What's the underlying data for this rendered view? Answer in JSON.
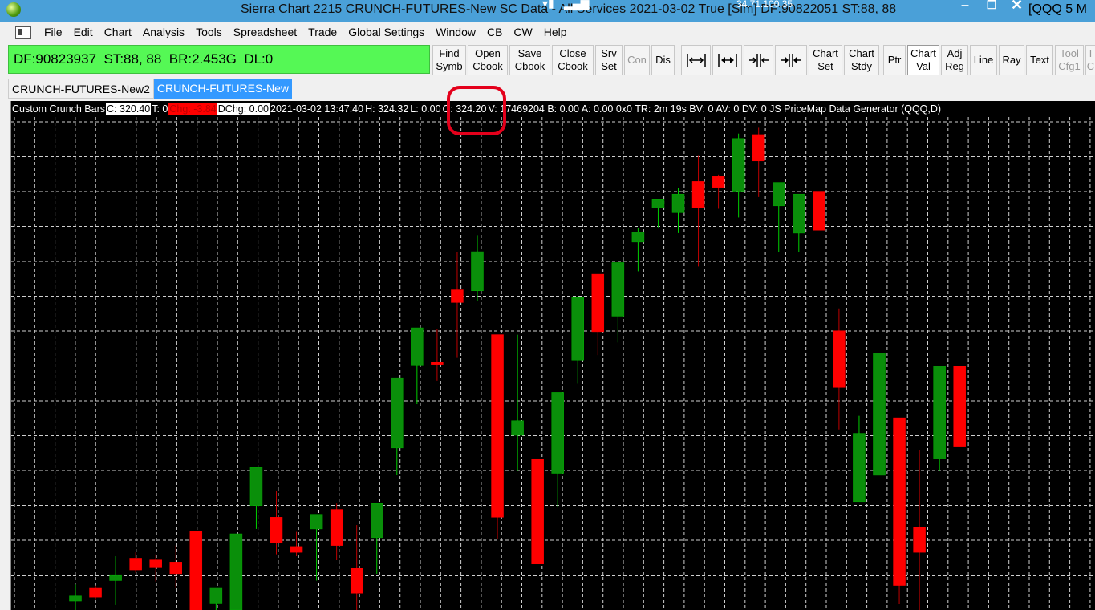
{
  "titlebar": {
    "title": "Sierra Chart 2215 CRUNCH-FUTURES-New   SC Data - All Services 2021-03-02   True [Sim]  DF:90822051  ST:88, 88",
    "ip": "34.71.100.35",
    "right_text": "[QQQ  5 M"
  },
  "menubar": {
    "items": [
      "File",
      "Edit",
      "Chart",
      "Analysis",
      "Tools",
      "Spreadsheet",
      "Trade",
      "Global Settings",
      "Window",
      "CB",
      "CW",
      "Help"
    ]
  },
  "status_panel": {
    "df": "DF:90823937",
    "st": "ST:88, 88",
    "br": "BR:2.453G",
    "dl": "DL:0",
    "color": "#55f855"
  },
  "toolbar": {
    "find_symb": [
      "Find",
      "Symb"
    ],
    "open_cbook": [
      "Open",
      "Cbook"
    ],
    "save_cbook": [
      "Save",
      "Cbook"
    ],
    "close_cbook": [
      "Close",
      "Cbook"
    ],
    "srv_set": [
      "Srv",
      "Set"
    ],
    "con": "Con",
    "dis": "Dis",
    "chart_set": [
      "Chart",
      "Set"
    ],
    "chart_stdy": [
      "Chart",
      "Stdy"
    ],
    "ptr": "Ptr",
    "chart_val": [
      "Chart",
      "Val"
    ],
    "adj_reg": [
      "Adj",
      "Reg"
    ],
    "line": "Line",
    "ray": "Ray",
    "text": "Text",
    "tool_cfg1": [
      "Tool",
      "Cfg1"
    ],
    "partial": [
      "T",
      "C"
    ]
  },
  "tabs": [
    {
      "label": "CRUNCH-FUTURES-New2",
      "active": false
    },
    {
      "label": "CRUNCH-FUTURES-New",
      "active": true
    }
  ],
  "chart_info": {
    "study": "Custom Crunch Bars",
    "c": "C: 320.40",
    "t": "T: 0",
    "chg": "Chg: -3.84",
    "dchg": "DChg: 0.00",
    "datetime": "2021-03-02 13:47:40",
    "h": "H: 324.32",
    "l": "L: 0.00",
    "o": "O: 324.20",
    "rest": "V: 17469204 B: 0.00 A: 0.00 0x0 TR: 2m 19s BV: 0 AV: 0 DV: 0 JS PriceMap Data Generator   (QQQ,D)"
  },
  "chart_data": {
    "type": "candlestick",
    "colors": {
      "up": "#0a8f0a",
      "down": "#ff0000",
      "up_wick": "#00d000",
      "down_wick": "#c00000",
      "grid": "#cfcfcf",
      "background": "#000000"
    },
    "candles": [
      {
        "o": 0.4,
        "h": 2.1,
        "l": -0.5,
        "c": 1.0
      },
      {
        "o": 1.8,
        "h": 2.0,
        "l": 0.6,
        "c": 0.8
      },
      {
        "o": 2.5,
        "h": 5.0,
        "l": 0.0,
        "c": 3.1
      },
      {
        "o": 4.8,
        "h": 5.4,
        "l": 3.3,
        "c": 3.6
      },
      {
        "o": 4.7,
        "h": 5.2,
        "l": 2.4,
        "c": 3.9
      },
      {
        "o": 4.4,
        "h": 6.1,
        "l": 1.8,
        "c": 3.2
      },
      {
        "o": 7.6,
        "h": 7.6,
        "l": -0.5,
        "c": -0.5
      },
      {
        "o": 0.2,
        "h": 1.8,
        "l": -0.5,
        "c": 1.8
      },
      {
        "o": -0.5,
        "h": 1.8,
        "l": -0.5,
        "c": 7.3
      },
      {
        "o": 10.2,
        "h": 14.1,
        "l": 7.8,
        "c": 14.1
      },
      {
        "o": 9.0,
        "h": 11.7,
        "l": 5.2,
        "c": 6.4
      },
      {
        "o": 6.0,
        "h": 7.5,
        "l": 5.0,
        "c": 5.4
      },
      {
        "o": 7.8,
        "h": 9.0,
        "l": 2.5,
        "c": 9.3
      },
      {
        "o": 9.8,
        "h": 10.4,
        "l": 4.6,
        "c": 6.1
      },
      {
        "o": 3.8,
        "h": 8.2,
        "l": -0.5,
        "c": 1.2
      },
      {
        "o": 6.9,
        "h": 7.8,
        "l": 3.2,
        "c": 10.4
      },
      {
        "o": 16.1,
        "h": 17.4,
        "l": 13.3,
        "c": 23.3
      },
      {
        "o": 24.6,
        "h": 26.9,
        "l": 20.6,
        "c": 28.4
      },
      {
        "o": 24.9,
        "h": 28.3,
        "l": 23.0,
        "c": 24.8
      },
      {
        "o": 32.3,
        "h": 36.2,
        "l": 25.4,
        "c": 31.0
      },
      {
        "o": 32.2,
        "h": 37.9,
        "l": 31.2,
        "c": 36.2
      },
      {
        "o": 27.7,
        "h": 27.7,
        "l": 6.8,
        "c": 9.0
      },
      {
        "o": 17.4,
        "h": 27.7,
        "l": 13.8,
        "c": 18.9
      },
      {
        "o": 15.0,
        "h": 15.0,
        "l": 4.2,
        "c": 4.2
      },
      {
        "o": 13.5,
        "h": 19.5,
        "l": 10.0,
        "c": 21.8
      },
      {
        "o": 25.1,
        "h": 26.9,
        "l": 22.7,
        "c": 31.5
      },
      {
        "o": 33.9,
        "h": 33.9,
        "l": 25.6,
        "c": 28.0
      },
      {
        "o": 29.6,
        "h": 34.8,
        "l": 26.9,
        "c": 35.1
      },
      {
        "o": 37.2,
        "h": 38.6,
        "l": 34.2,
        "c": 38.2
      },
      {
        "o": 40.7,
        "h": 41.4,
        "l": 38.7,
        "c": 41.6
      },
      {
        "o": 40.2,
        "h": 42.7,
        "l": 38.1,
        "c": 42.1
      },
      {
        "o": 43.4,
        "h": 46.1,
        "l": 34.7,
        "c": 40.7
      },
      {
        "o": 43.9,
        "h": 44.1,
        "l": 40.6,
        "c": 42.8
      },
      {
        "o": 42.4,
        "h": 48.3,
        "l": 39.7,
        "c": 47.8
      },
      {
        "o": 48.2,
        "h": 48.9,
        "l": 41.8,
        "c": 45.5
      },
      {
        "o": 40.9,
        "h": 42.7,
        "l": 36.2,
        "c": 43.3
      },
      {
        "o": 38.1,
        "h": 40.6,
        "l": 36.2,
        "c": 42.1
      },
      {
        "o": 42.4,
        "h": 42.4,
        "l": 38.4,
        "c": 38.4
      },
      {
        "o": 28.1,
        "h": 30.4,
        "l": 18.0,
        "c": 22.3
      },
      {
        "o": 10.6,
        "h": 19.4,
        "l": 10.6,
        "c": 17.6
      },
      {
        "o": 13.3,
        "h": 25.8,
        "l": 13.3,
        "c": 25.8
      },
      {
        "o": 19.2,
        "h": 19.2,
        "l": 0.1,
        "c": 2.0
      },
      {
        "o": 8.0,
        "h": 15.9,
        "l": -0.5,
        "c": 5.4
      },
      {
        "o": 15.0,
        "h": 24.5,
        "l": 13.8,
        "c": 24.5
      },
      {
        "o": 24.5,
        "h": 24.5,
        "l": 16.2,
        "c": 16.2
      }
    ]
  }
}
